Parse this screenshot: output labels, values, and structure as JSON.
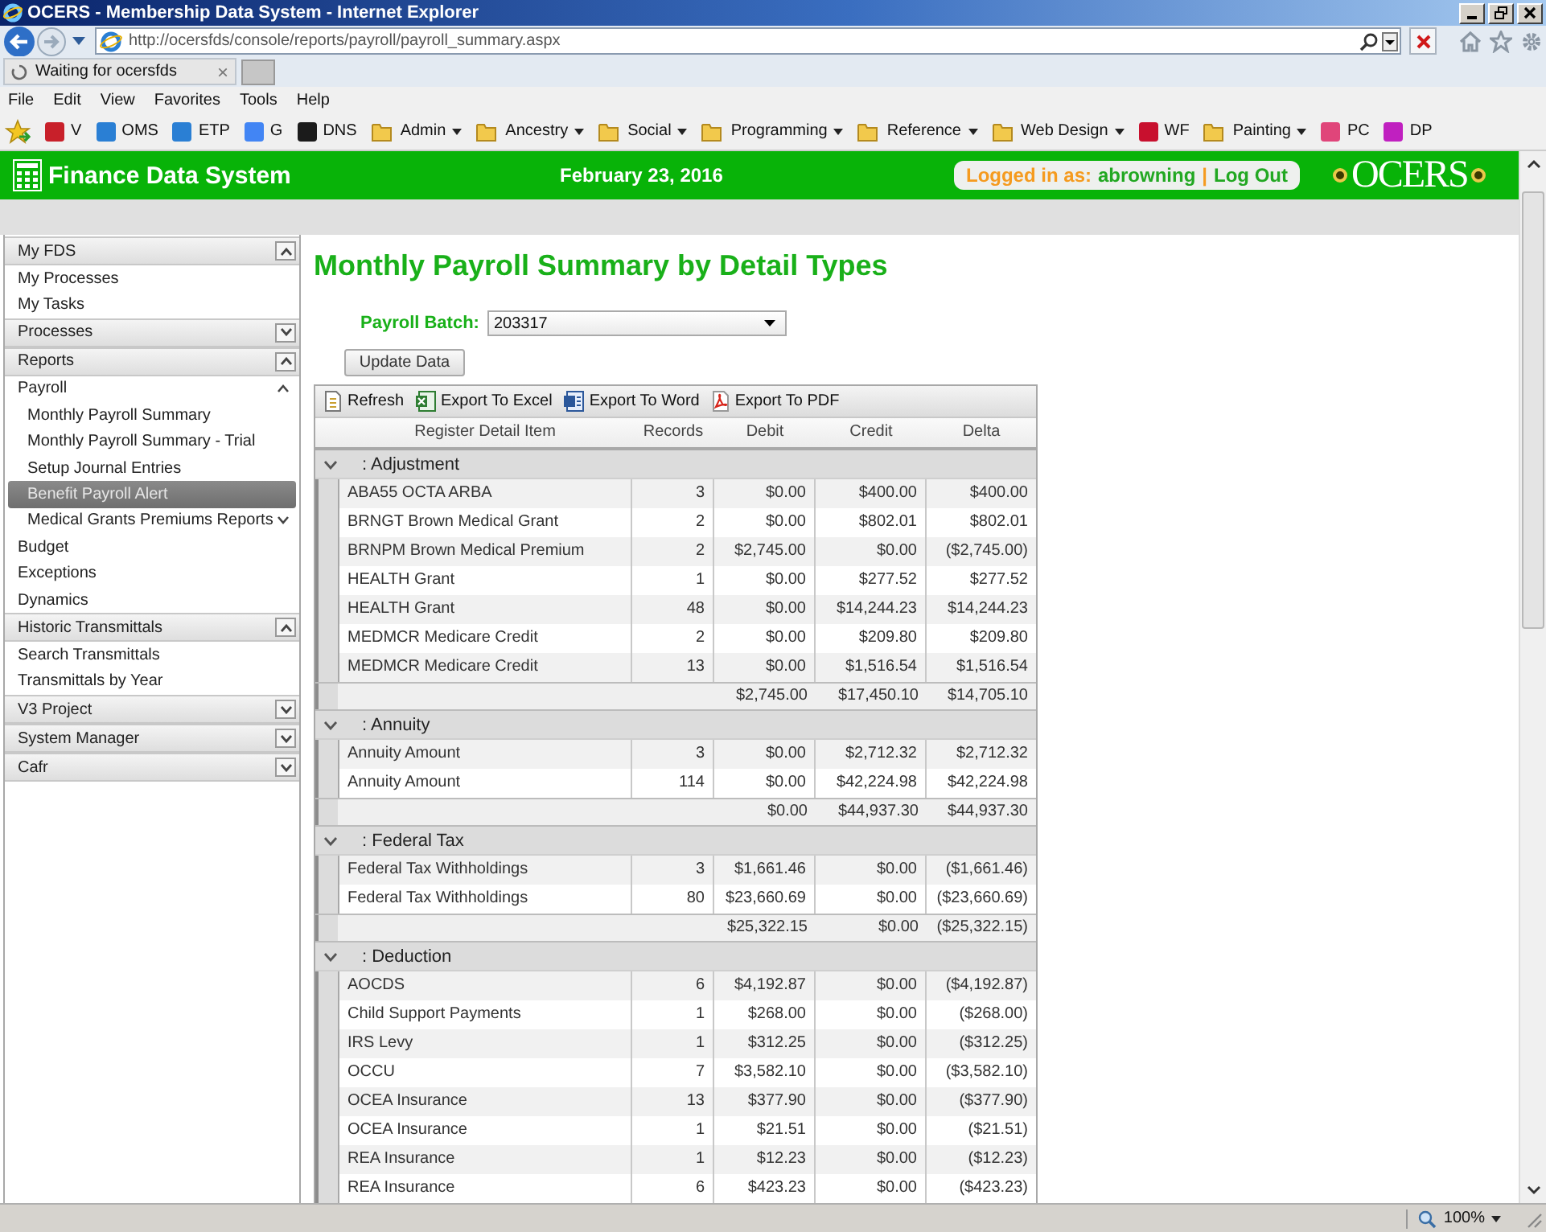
{
  "window": {
    "title": "OCERS - Membership Data System - Internet Explorer"
  },
  "address_bar": {
    "url": "http://ocersfds/console/reports/payroll/payroll_summary.aspx"
  },
  "browser_tab": {
    "label": "Waiting for ocersfds",
    "close": "×"
  },
  "menu": [
    "File",
    "Edit",
    "View",
    "Favorites",
    "Tools",
    "Help"
  ],
  "favorites": [
    {
      "label": "V",
      "kind": "site",
      "color": "#c8202a"
    },
    {
      "label": "OMS",
      "kind": "site",
      "color": "#2a7fd4"
    },
    {
      "label": "ETP",
      "kind": "site",
      "color": "#2a7fd4"
    },
    {
      "label": "G",
      "kind": "site",
      "color": "#4285f4"
    },
    {
      "label": "DNS",
      "kind": "site",
      "color": "#1b1b1b"
    },
    {
      "label": "Admin",
      "kind": "folder"
    },
    {
      "label": "Ancestry",
      "kind": "folder"
    },
    {
      "label": "Social",
      "kind": "folder"
    },
    {
      "label": "Programming",
      "kind": "folder"
    },
    {
      "label": "Reference",
      "kind": "folder"
    },
    {
      "label": "Web Design",
      "kind": "folder"
    },
    {
      "label": "WF",
      "kind": "site",
      "color": "#c8102e"
    },
    {
      "label": "Painting",
      "kind": "folder"
    },
    {
      "label": "PC",
      "kind": "site",
      "color": "#e0457a"
    },
    {
      "label": "DP",
      "kind": "site",
      "color": "#c020c0"
    }
  ],
  "header": {
    "app_name": "Finance Data System",
    "date": "February 23, 2016",
    "login_prefix": "Logged in as:",
    "user": "abrowning",
    "separator": "|",
    "logout": "Log Out",
    "logo": "OCERS"
  },
  "sidebar": {
    "sections": [
      {
        "label": "My FDS",
        "expanded": true,
        "items": [
          {
            "label": "My Processes",
            "selected": false
          },
          {
            "label": "My Tasks",
            "selected": false
          }
        ]
      },
      {
        "label": "Processes",
        "expanded": false
      },
      {
        "label": "Reports",
        "expanded": true,
        "items": [
          {
            "label": "Payroll",
            "selected": false,
            "expanded": true,
            "children": [
              {
                "label": "Monthly Payroll Summary",
                "selected": false
              },
              {
                "label": "Monthly Payroll Summary - Trial",
                "selected": false
              },
              {
                "label": "Setup Journal Entries",
                "selected": false
              },
              {
                "label": "Benefit Payroll Alert",
                "selected": true
              },
              {
                "label": "Medical Grants Premiums Reports",
                "selected": false,
                "expanded": false
              }
            ]
          },
          {
            "label": "Budget",
            "selected": false
          },
          {
            "label": "Exceptions",
            "selected": false
          },
          {
            "label": "Dynamics",
            "selected": false
          }
        ]
      },
      {
        "label": "Historic Transmittals",
        "expanded": true,
        "items": [
          {
            "label": "Search Transmittals",
            "selected": false
          },
          {
            "label": "Transmittals by Year",
            "selected": false
          }
        ]
      },
      {
        "label": "V3 Project",
        "expanded": false
      },
      {
        "label": "System Manager",
        "expanded": false
      },
      {
        "label": "Cafr",
        "expanded": false
      }
    ]
  },
  "report": {
    "title": "Monthly Payroll Summary by Detail Types",
    "batch_label": "Payroll Batch:",
    "batch_value": "203317",
    "update_button": "Update Data",
    "toolbar": [
      {
        "label": "Refresh",
        "kind": "refresh"
      },
      {
        "label": "Export To Excel",
        "kind": "excel"
      },
      {
        "label": "Export To Word",
        "kind": "word"
      },
      {
        "label": "Export To PDF",
        "kind": "pdf"
      }
    ],
    "columns": [
      "Register Detail Item",
      "Records",
      "Debit",
      "Credit",
      "Delta"
    ],
    "groups": [
      {
        "title": ": Adjustment",
        "expanded": true,
        "rows": [
          [
            "ABA55 OCTA ARBA",
            "3",
            "$0.00",
            "$400.00",
            "$400.00"
          ],
          [
            "BRNGT Brown Medical Grant",
            "2",
            "$0.00",
            "$802.01",
            "$802.01"
          ],
          [
            "BRNPM Brown Medical Premium",
            "2",
            "$2,745.00",
            "$0.00",
            "($2,745.00)"
          ],
          [
            "HEALTH Grant",
            "1",
            "$0.00",
            "$277.52",
            "$277.52"
          ],
          [
            "HEALTH Grant",
            "48",
            "$0.00",
            "$14,244.23",
            "$14,244.23"
          ],
          [
            "MEDMCR Medicare Credit",
            "2",
            "$0.00",
            "$209.80",
            "$209.80"
          ],
          [
            "MEDMCR Medicare Credit",
            "13",
            "$0.00",
            "$1,516.54",
            "$1,516.54"
          ]
        ],
        "totals": [
          "$2,745.00",
          "$17,450.10",
          "$14,705.10"
        ]
      },
      {
        "title": ": Annuity",
        "expanded": true,
        "rows": [
          [
            "Annuity Amount",
            "3",
            "$0.00",
            "$2,712.32",
            "$2,712.32"
          ],
          [
            "Annuity Amount",
            "114",
            "$0.00",
            "$42,224.98",
            "$42,224.98"
          ]
        ],
        "totals": [
          "$0.00",
          "$44,937.30",
          "$44,937.30"
        ]
      },
      {
        "title": ": Federal Tax",
        "expanded": true,
        "rows": [
          [
            "Federal Tax Withholdings",
            "3",
            "$1,661.46",
            "$0.00",
            "($1,661.46)"
          ],
          [
            "Federal Tax Withholdings",
            "80",
            "$23,660.69",
            "$0.00",
            "($23,660.69)"
          ]
        ],
        "totals": [
          "$25,322.15",
          "$0.00",
          "($25,322.15)"
        ]
      },
      {
        "title": ": Deduction",
        "expanded": true,
        "rows": [
          [
            "AOCDS",
            "6",
            "$4,192.87",
            "$0.00",
            "($4,192.87)"
          ],
          [
            "Child Support Payments",
            "1",
            "$268.00",
            "$0.00",
            "($268.00)"
          ],
          [
            "IRS Levy",
            "1",
            "$312.25",
            "$0.00",
            "($312.25)"
          ],
          [
            "OCCU",
            "7",
            "$3,582.10",
            "$0.00",
            "($3,582.10)"
          ],
          [
            "OCEA Insurance",
            "13",
            "$377.90",
            "$0.00",
            "($377.90)"
          ],
          [
            "OCEA Insurance",
            "1",
            "$21.51",
            "$0.00",
            "($21.51)"
          ],
          [
            "REA Insurance",
            "1",
            "$12.23",
            "$0.00",
            "($12.23)"
          ],
          [
            "REA Insurance",
            "6",
            "$423.23",
            "$0.00",
            "($423.23)"
          ]
        ]
      }
    ]
  },
  "status_bar": {
    "zoom": "100%"
  }
}
